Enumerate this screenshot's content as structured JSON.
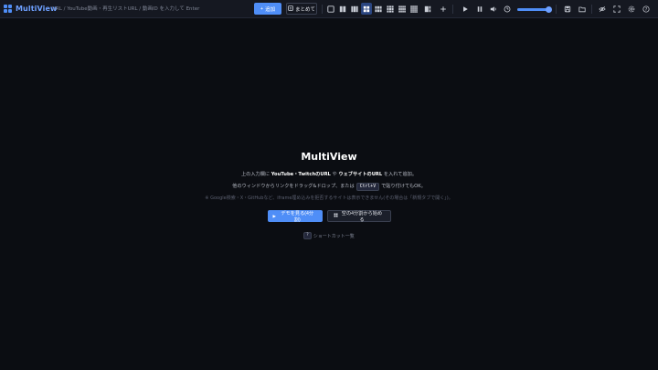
{
  "toolbar": {
    "app_title": "MultiView",
    "url_placeholder": "URL / YouTube動画・再生リストURL / 動画ID を入力して Enter",
    "add_label": "追加",
    "batch_label": "まとめて",
    "icons": [
      "layout-1-icon",
      "layout-2-icon",
      "layout-3-icon",
      "layout-4-icon",
      "layout-6-icon",
      "layout-9-icon",
      "layout-12-icon",
      "layout-16-icon",
      "add-slot-icon",
      "play-icon",
      "pause-icon",
      "volume-icon",
      "timer-icon",
      "save-icon",
      "folder-icon",
      "hide-icon",
      "fullscreen-icon",
      "settings-icon",
      "help-icon"
    ],
    "active_layout": "layout-4-icon",
    "accent_color": "#4f8ef7",
    "volume": 0.95
  },
  "welcome": {
    "title": "MultiView",
    "line1_pre": "上の入力欄に ",
    "line1_bold": "YouTube・TwitchのURL",
    "line1_mid": " や ",
    "line1_bold2": "ウェブサイトのURL",
    "line1_post": " を入れて追加。",
    "line2_pre": "他のウィンドウからリンクをドラッグ&ドロップ、または",
    "line2_kbd": "Ctrl+V",
    "line2_post": "で貼り付けてもOK。",
    "line3": "※ Google検索・X・GitHubなど、iframe埋め込みを拒否するサイトは表示できません(その場合は「新規タブで開く」)。",
    "demo_label": "デモを見る(4分割)",
    "empty_label": "空の4分割から始める",
    "shortcut_key": "?",
    "shortcut_label": "ショートカット一覧"
  }
}
